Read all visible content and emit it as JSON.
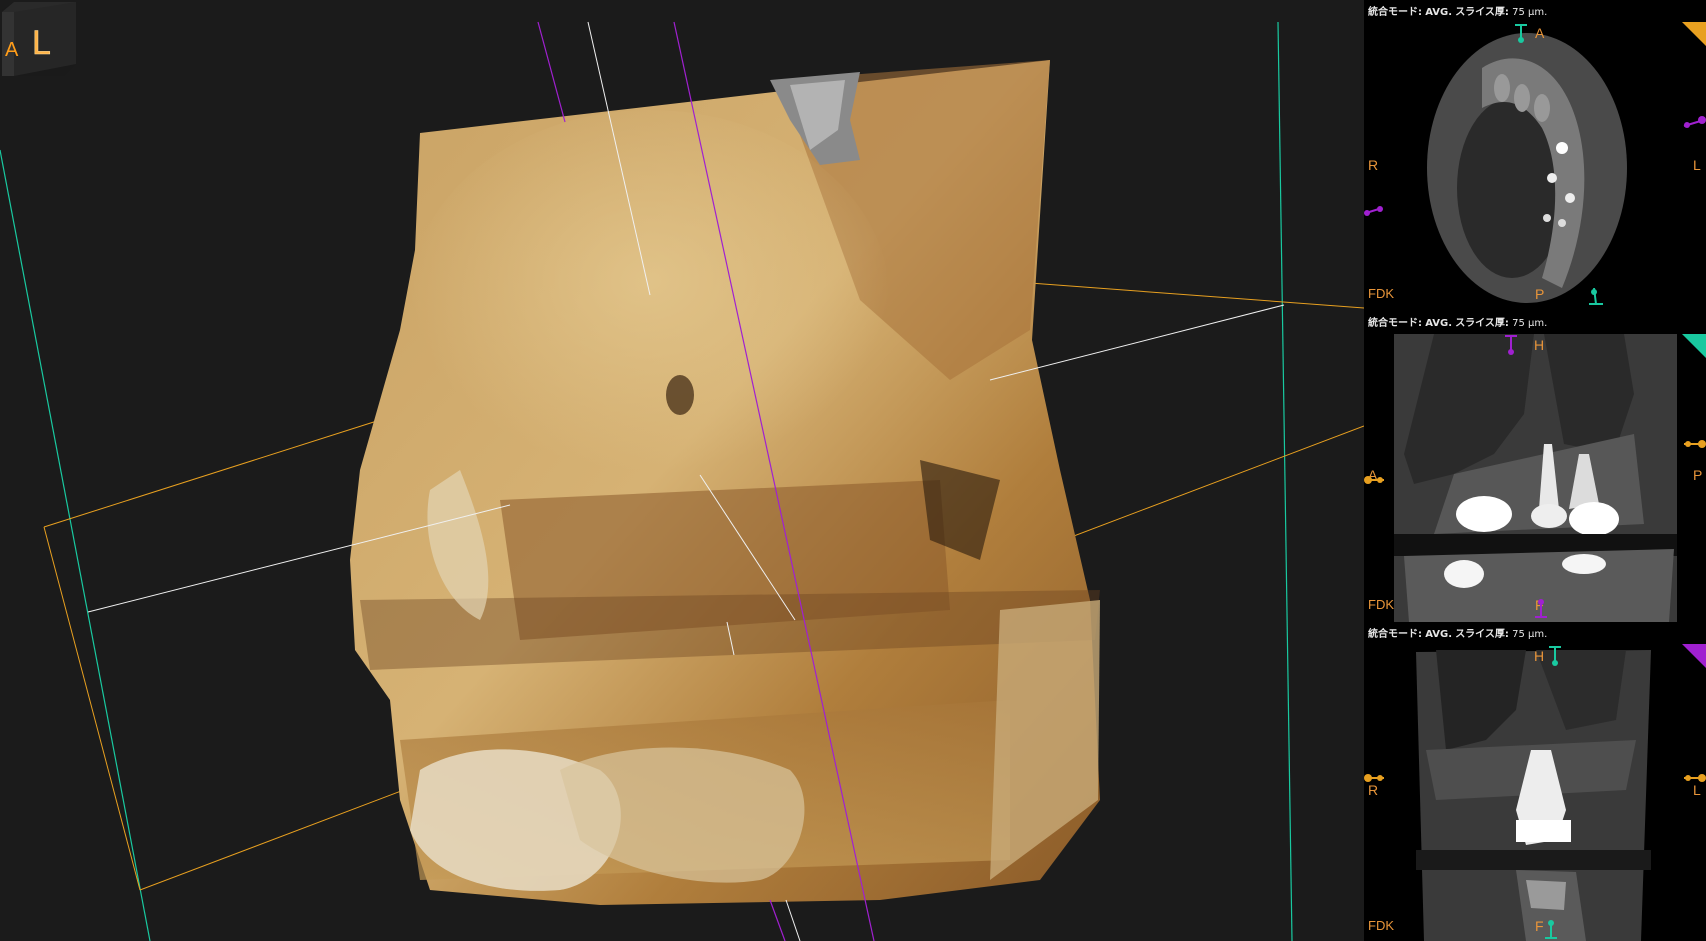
{
  "sidebar": {
    "panes": [
      {
        "header_mode_label": "統合モード:",
        "header_mode_value": "AVG.",
        "header_thickness_label": "スライス厚:",
        "header_thickness_value": "75 μm.",
        "top_label": "A",
        "bottom_label": "P",
        "left_label": "R",
        "right_label": "L",
        "corner_label": "FDK",
        "corner_color": "#e8a020"
      },
      {
        "header_mode_label": "統合モード:",
        "header_mode_value": "AVG.",
        "header_thickness_label": "スライス厚:",
        "header_thickness_value": "75 μm.",
        "top_label": "H",
        "bottom_label": "F",
        "left_label": "A",
        "right_label": "P",
        "corner_label": "FDK",
        "corner_color": "#19c9a0"
      },
      {
        "header_mode_label": "統合モード:",
        "header_mode_value": "AVG.",
        "header_thickness_label": "スライス厚:",
        "header_thickness_value": "75 μm.",
        "top_label": "H",
        "bottom_label": "F",
        "left_label": "R",
        "right_label": "L",
        "corner_label": "FDK",
        "corner_color": "#a020d0"
      }
    ]
  },
  "view3d": {
    "orientation_cube_face": "L",
    "orientation_cube_side": "A"
  },
  "colors": {
    "axial": "#e8a020",
    "coronal": "#19c9a0",
    "sagittal": "#a020d0",
    "label": "#e8953a",
    "bone": "#b88a3c"
  }
}
